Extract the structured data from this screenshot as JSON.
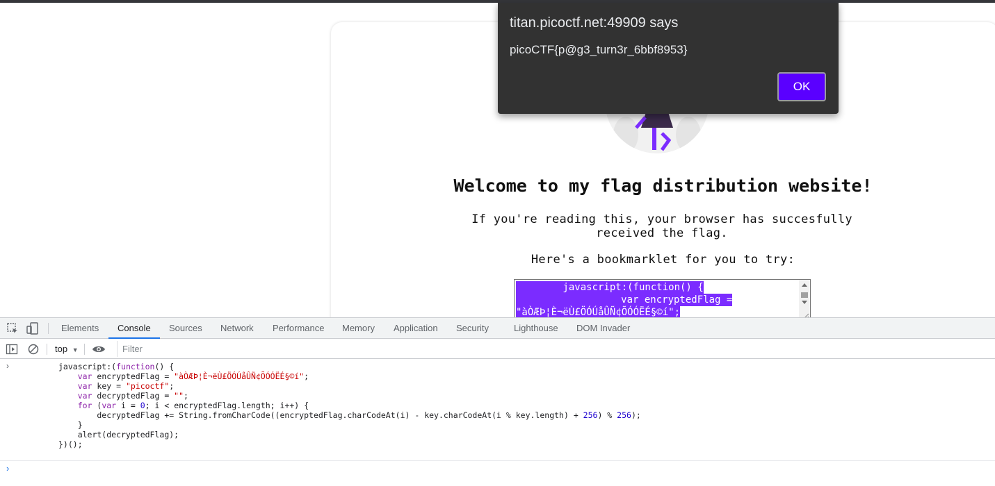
{
  "dialog": {
    "title": "titan.picoctf.net:49909 says",
    "message": "picoCTF{p@g3_turn3r_6bbf8953}",
    "ok_label": "OK"
  },
  "page": {
    "heading": "Welcome to my flag distribution website!",
    "subtext_line1": "If you're reading this, your browser has succesfully",
    "subtext_line2": "received the flag.",
    "bookmarklet_intro": "Here's a bookmarklet for you to try:",
    "textarea_line1": "        javascript:(function() {",
    "textarea_line2": "            var encryptedFlag =",
    "textarea_line3": "\"àÒÆÞ¦È¬ëÙ£ÖÓÚåÛÑ¢ÕÓÓËÉ§©í\";"
  },
  "devtools": {
    "tabs": [
      "Elements",
      "Console",
      "Sources",
      "Network",
      "Performance",
      "Memory",
      "Application",
      "Security",
      "Lighthouse",
      "DOM Invader"
    ],
    "active_tab": "Console",
    "context_label": "top",
    "filter_placeholder": "Filter",
    "code": {
      "l1_a": "javascript:(",
      "l1_kw": "function",
      "l1_b": "() {",
      "l2_kw": "    var",
      "l2_a": " encryptedFlag = ",
      "l2_str": "\"àÒÆÞ¦È¬ëÙ£ÖÓÚåÛÑ¢ÕÓÓËÉ§©í\"",
      "l2_b": ";",
      "l3_kw": "    var",
      "l3_a": " key = ",
      "l3_str": "\"picoctf\"",
      "l3_b": ";",
      "l4_kw": "    var",
      "l4_a": " decryptedFlag = ",
      "l4_str": "\"\"",
      "l4_b": ";",
      "l5_kw": "    for",
      "l5_a": " (",
      "l5_kw2": "var",
      "l5_b": " i = ",
      "l5_num": "0",
      "l5_c": "; i < encryptedFlag.length; i++) {",
      "l6_a": "        decryptedFlag += String.fromCharCode((encryptedFlag.charCodeAt(i) - key.charCodeAt(i % key.length) + ",
      "l6_num1": "256",
      "l6_b": ") % ",
      "l6_num2": "256",
      "l6_c": ");",
      "l7": "    }",
      "l8": "    alert(decryptedFlag);",
      "l9": "})();"
    }
  }
}
